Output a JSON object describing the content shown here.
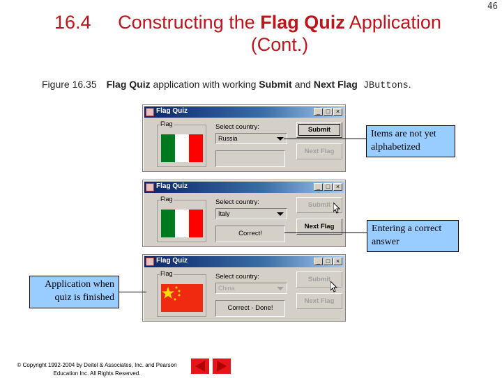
{
  "slide": {
    "number": "46",
    "title_number": "16.4",
    "title_pre": "Constructing the ",
    "title_bold": "Flag Quiz",
    "title_post": " Application",
    "title_line2": "(Cont.)",
    "caption_figure": "Figure 16.35",
    "caption_bold1": "Flag Quiz",
    "caption_text1": " application with working ",
    "caption_bold2": "Submit",
    "caption_text2": " and ",
    "caption_bold3": "Next Flag",
    "caption_mono": " JButtons",
    "caption_end": "."
  },
  "windows": [
    {
      "title": "Flag Quiz",
      "group_label": "Flag",
      "flag": "italy",
      "select_label": "Select country:",
      "combo_value": "Russia",
      "combo_enabled": true,
      "result_text": "",
      "submit_label": "Submit",
      "submit_enabled": true,
      "next_label": "Next Flag",
      "next_enabled": false
    },
    {
      "title": "Flag Quiz",
      "group_label": "Flag",
      "flag": "italy",
      "select_label": "Select country:",
      "combo_value": "Italy",
      "combo_enabled": true,
      "result_text": "Correct!",
      "submit_label": "Submit",
      "submit_enabled": false,
      "next_label": "Next Flag",
      "next_enabled": true
    },
    {
      "title": "Flag Quiz",
      "group_label": "Flag",
      "flag": "china",
      "select_label": "Select country:",
      "combo_value": "China",
      "combo_enabled": false,
      "result_text": "Correct - Done!",
      "submit_label": "Submit",
      "submit_enabled": false,
      "next_label": "Next Flag",
      "next_enabled": false
    }
  ],
  "window_controls": {
    "minimize": "_",
    "maximize": "□",
    "close": "×"
  },
  "callouts": {
    "items_not_alphabetized": "Items are not yet alphabetized",
    "entering_correct": "Entering a correct answer",
    "quiz_finished": "Application when quiz is finished"
  },
  "footer": {
    "copyright_line1": "© Copyright 1992-2004 by Deitel & Associates, Inc. and Pearson",
    "copyright_line2": "Education Inc. All Rights Reserved.",
    "prev_icon": "previous-slide-arrow",
    "next_icon": "next-slide-arrow"
  },
  "colors": {
    "title_red": "#c0141b",
    "callout_blue": "#99ccff",
    "nav_red": "#e8141b",
    "italy_green": "#007a1f",
    "italy_red": "#ff0000",
    "china_red": "#f02a10",
    "china_star": "#ffde00"
  }
}
